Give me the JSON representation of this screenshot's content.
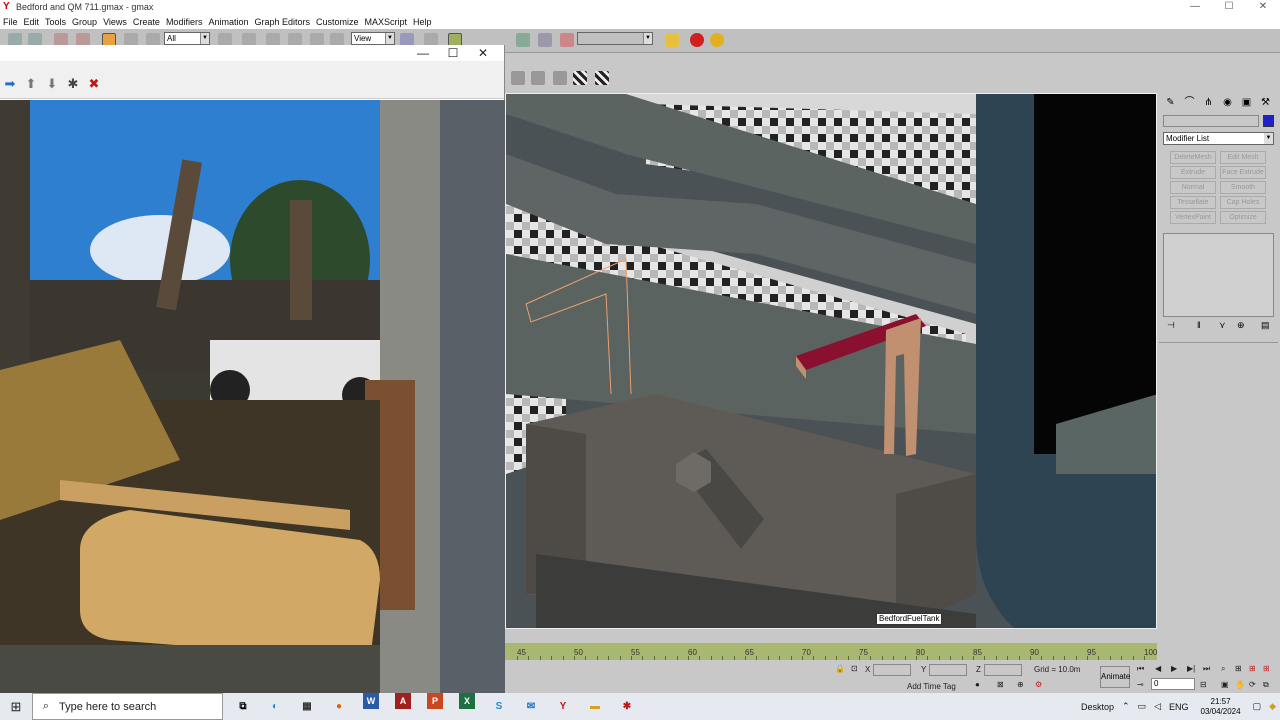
{
  "window": {
    "title": "Bedford and QM 711.gmax - gmax",
    "min": "—",
    "max": "☐",
    "close": "✕"
  },
  "menu": [
    "File",
    "Edit",
    "Tools",
    "Group",
    "Views",
    "Create",
    "Modifiers",
    "Animation",
    "Graph Editors",
    "Customize",
    "MAXScript",
    "Help"
  ],
  "toolbar": {
    "selection_filter": "All",
    "ref_coord": "View",
    "named_selection": ""
  },
  "image_window": {
    "min": "—",
    "max": "☐",
    "close": "✕"
  },
  "viewport": {
    "object_label": "BedfordFuelTank"
  },
  "command_panel": {
    "modifier_list": "Modifier List",
    "modifier_buttons": [
      "DeleteMesh",
      "Edit Mesh",
      "Extrude",
      "Face Extrude",
      "Normal",
      "Smooth",
      "Tessellate",
      "Cap Holes",
      "VertexPaint",
      "Optimize"
    ]
  },
  "timeline": {
    "labels": [
      "45",
      "50",
      "55",
      "60",
      "65",
      "70",
      "75",
      "80",
      "85",
      "90",
      "95",
      "100"
    ]
  },
  "status": {
    "x_label": "X",
    "y_label": "Y",
    "z_label": "Z",
    "grid": "Grid = 10.0m",
    "add_time_tag": "Add Time Tag",
    "animate": "Animate",
    "frame": "0"
  },
  "taskbar": {
    "search_placeholder": "Type here to search",
    "desktop": "Desktop",
    "lang": "ENG",
    "time": "21:57",
    "date": "03/04/2024"
  },
  "colors": {
    "accent_magenta": "#8a1030",
    "timeline": "#a8b870",
    "swatch": "#2020c8"
  }
}
